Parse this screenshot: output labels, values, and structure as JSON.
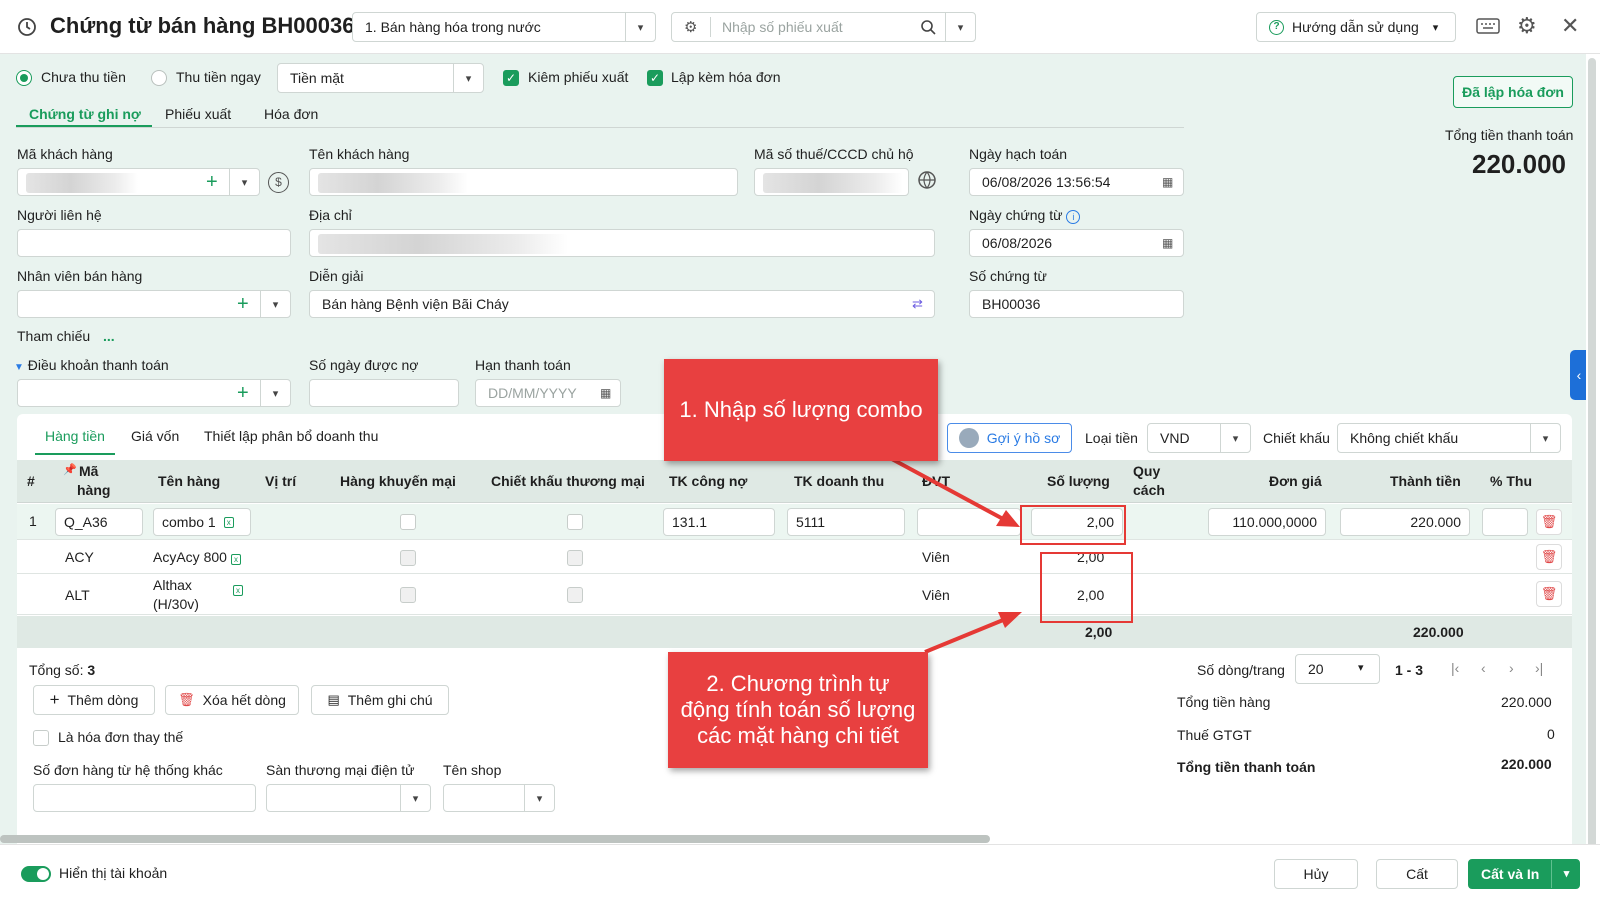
{
  "header": {
    "title": "Chứng từ bán hàng BH00036",
    "sale_type": "1. Bán hàng hóa trong nước",
    "search_placeholder": "Nhập số phiếu xuất",
    "help_label": "Hướng dẫn sử dụng"
  },
  "options": {
    "unpaid_label": "Chưa thu tiền",
    "paid_label": "Thu tiền ngay",
    "payment_method": "Tiền mặt",
    "export_check_label": "Kiêm phiếu xuất",
    "invoice_check_label": "Lập kèm hóa đơn"
  },
  "tabs": [
    "Chứng từ ghi nợ",
    "Phiếu xuất",
    "Hóa đơn"
  ],
  "status_button": "Đã lập hóa đơn",
  "total": {
    "label": "Tổng tiền thanh toán",
    "value": "220.000"
  },
  "form": {
    "customer_code_label": "Mã khách hàng",
    "customer_name_label": "Tên khách hàng",
    "tax_id_label": "Mã số thuế/CCCD chủ hộ",
    "posting_date_label": "Ngày hạch toán",
    "posting_date": "06/08/2026 13:56:54",
    "contact_label": "Người liên hệ",
    "address_label": "Địa chỉ",
    "voucher_date_label": "Ngày chứng từ",
    "voucher_date": "06/08/2026",
    "salesperson_label": "Nhân viên bán hàng",
    "description_label": "Diễn giải",
    "description": "Bán hàng Bệnh viện Bãi Cháy",
    "voucher_no_label": "Số chứng từ",
    "voucher_no": "BH00036",
    "reference_label": "Tham chiếu",
    "reference_more": "...",
    "payment_terms_label": "Điều khoản thanh toán",
    "credit_days_label": "Số ngày được nợ",
    "due_date_label": "Hạn thanh toán",
    "due_date_placeholder": "DD/MM/YYYY"
  },
  "grid_tabs": [
    "Hàng tiền",
    "Giá vốn",
    "Thiết lập phân bổ doanh thu"
  ],
  "grid_toolbar": {
    "suggest_label": "Gợi ý hồ sơ",
    "currency_label": "Loại tiền",
    "currency": "VND",
    "discount_label": "Chiết khấu",
    "discount": "Không chiết khấu"
  },
  "columns": {
    "index": "#",
    "code_1": "Mã",
    "code_2": "hàng",
    "name": "Tên hàng",
    "location": "Vị trí",
    "promo": "Hàng khuyến mại",
    "trade_discount": "Chiết khấu thương mại",
    "debt_account": "TK công nợ",
    "revenue_account": "TK doanh thu",
    "unit": "ĐVT",
    "quantity": "Số lượng",
    "spec_1": "Quy",
    "spec_2": "cách",
    "unit_price": "Đơn giá",
    "amount": "Thành tiền",
    "tax_pct": "% Thu"
  },
  "rows": [
    {
      "index": "1",
      "code": "Q_A36",
      "name": "combo 1",
      "debt_account": "131.1",
      "revenue_account": "5111",
      "unit": "",
      "quantity": "2,00",
      "unit_price": "110.000,0000",
      "amount": "220.000"
    },
    {
      "index": "",
      "code": "ACY",
      "name": "AcyAcy 800",
      "unit": "Viên",
      "quantity": "2,00"
    },
    {
      "index": "",
      "code": "ALT",
      "name_1": "Althax",
      "name_2": "(H/30v)",
      "unit": "Viên",
      "quantity": "2,00"
    }
  ],
  "totals_row": {
    "quantity": "2,00",
    "amount": "220.000"
  },
  "summary": {
    "count_label": "Tổng số:",
    "count": "3",
    "per_page_label": "Số dòng/trang",
    "per_page": "20",
    "range": "1 - 3",
    "goods_total_label": "Tổng tiền hàng",
    "goods_total": "220.000",
    "vat_label": "Thuế GTGT",
    "vat": "0",
    "grand_total_label": "Tổng tiền thanh toán",
    "grand_total": "220.000"
  },
  "actions": {
    "add_row": "Thêm dòng",
    "delete_all": "Xóa hết dòng",
    "add_note": "Thêm ghi chú",
    "replacement_invoice": "Là hóa đơn thay thế",
    "external_order_label": "Số đơn hàng từ hệ thống khác",
    "ecommerce_label": "Sàn thương mại điện tử",
    "shop_label": "Tên shop"
  },
  "footer": {
    "show_account_label": "Hiển thị tài khoản",
    "cancel": "Hủy",
    "save": "Cất",
    "save_print": "Cất và In"
  },
  "annotations": {
    "callout_1": "1. Nhập số lượng combo",
    "callout_2_l1": "2. Chương trình tự",
    "callout_2_l2": "động tính toán số lượng",
    "callout_2_l3": "các mặt hàng chi tiết"
  },
  "colors": {
    "accent": "#1a9c5c",
    "background": "#e9f3ef",
    "callout": "#e84040"
  }
}
